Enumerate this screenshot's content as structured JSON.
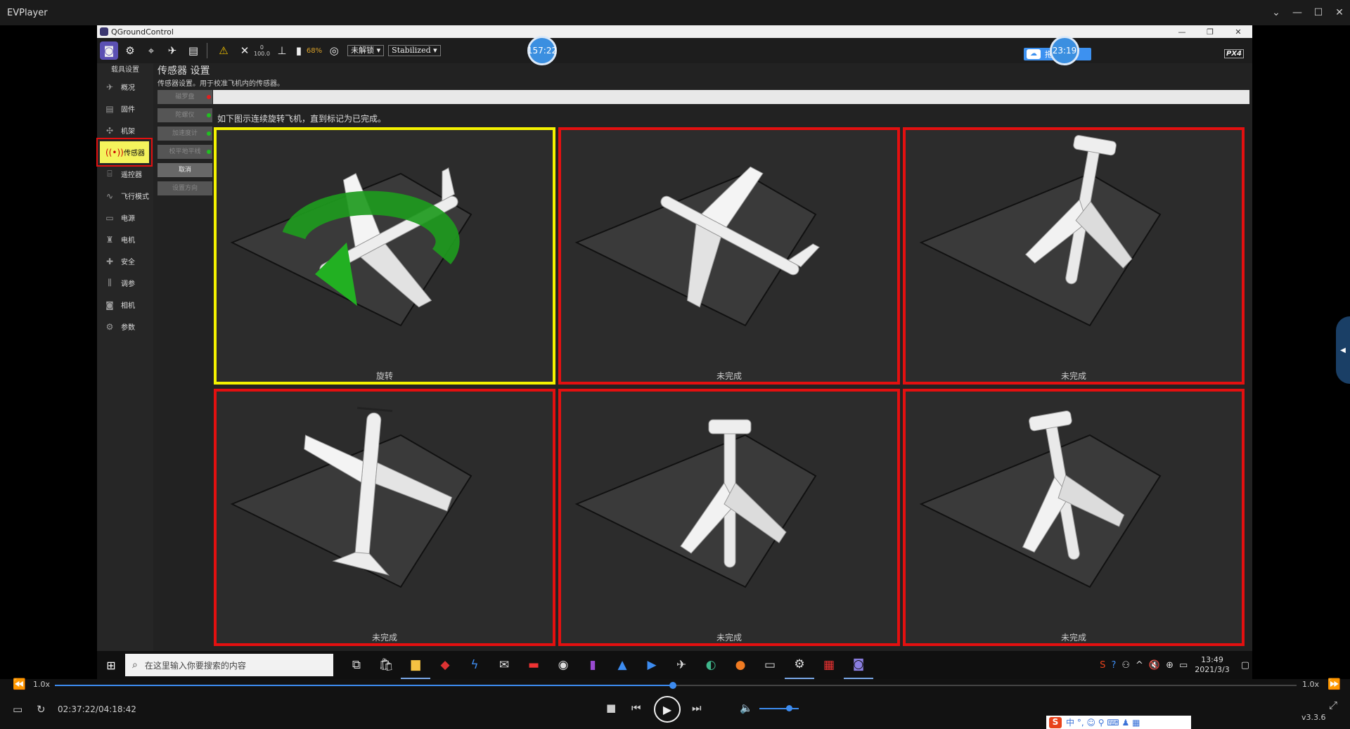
{
  "player": {
    "title": "EVPlayer",
    "speed_left": "1.0x",
    "speed_right": "1.0x",
    "time": "02:37:22/04:18:42",
    "progress_fraction": 0.498,
    "volume_fraction": 0.7,
    "version": "v3.3.6"
  },
  "qgc": {
    "window_title": "QGroundControl",
    "toolbar": {
      "gps_count": "0",
      "hdop": "100.0",
      "battery": "68%",
      "arm_state": "未解锁",
      "flight_mode": "Stabilized",
      "timer_left": "157:22",
      "timer_right": "23:19",
      "upload_label": "拖拽上传",
      "px4_label": "PX4"
    },
    "nav": {
      "header": "载具设置",
      "items": [
        {
          "label": "概况",
          "icon": "plane-icon"
        },
        {
          "label": "固件",
          "icon": "firmware-icon"
        },
        {
          "label": "机架",
          "icon": "airframe-icon"
        },
        {
          "label": "传感器",
          "icon": "sensor-icon"
        },
        {
          "label": "遥控器",
          "icon": "radio-icon"
        },
        {
          "label": "飞行模式",
          "icon": "flightmode-icon"
        },
        {
          "label": "电源",
          "icon": "power-icon"
        },
        {
          "label": "电机",
          "icon": "motor-icon"
        },
        {
          "label": "安全",
          "icon": "safety-icon"
        },
        {
          "label": "调参",
          "icon": "tuning-icon"
        },
        {
          "label": "相机",
          "icon": "camera-icon"
        },
        {
          "label": "参数",
          "icon": "parameters-icon"
        }
      ],
      "selected_index": 3
    },
    "sensors": {
      "title": "传感器 设置",
      "subtitle": "传感器设置。用于校准飞机内的传感器。",
      "instruction": "如下图示连续旋转飞机，直到标记为已完成。",
      "buttons": [
        {
          "label": "磁罗盘",
          "status_color": "#e02020"
        },
        {
          "label": "陀螺仪",
          "status_color": "#20c020"
        },
        {
          "label": "加速度计",
          "status_color": "#20c020"
        },
        {
          "label": "校平地平线",
          "status_color": "#20c020"
        },
        {
          "label": "取消",
          "status_color": ""
        },
        {
          "label": "设置方向",
          "status_color": ""
        }
      ],
      "cells": [
        {
          "label": "旋转",
          "state": "active"
        },
        {
          "label": "未完成",
          "state": "incomplete"
        },
        {
          "label": "未完成",
          "state": "incomplete"
        },
        {
          "label": "未完成",
          "state": "incomplete"
        },
        {
          "label": "未完成",
          "state": "incomplete"
        },
        {
          "label": "未完成",
          "state": "incomplete"
        }
      ]
    }
  },
  "taskbar": {
    "search_placeholder": "在这里输入你要搜索的内容",
    "time": "13:49",
    "date": "2021/3/3"
  },
  "ime": {
    "label": "中 °, ☺ ⚲ ⌨ ♟ ▦"
  },
  "colors": {
    "active_border": "#f4f200",
    "incomplete_border": "#e31010",
    "accent": "#3d8cf0"
  }
}
